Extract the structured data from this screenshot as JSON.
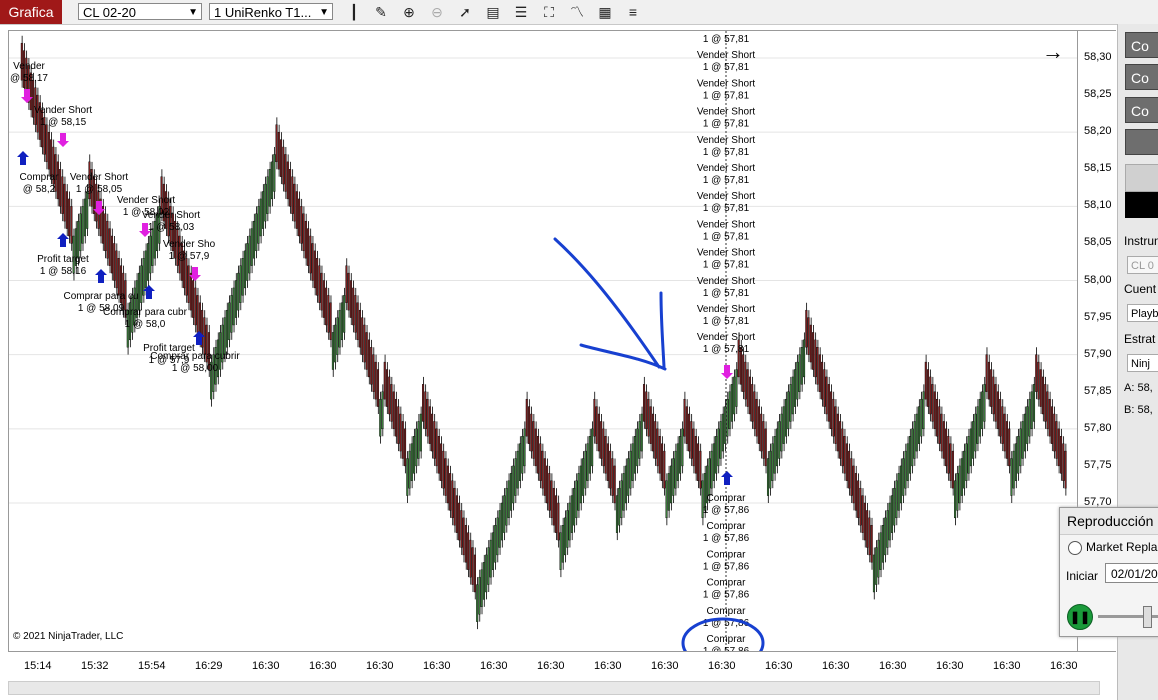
{
  "toolbar": {
    "tab_label": "Grafica",
    "instrument_select": "CL 02-20",
    "interval_select": "1 UniRenko T1...",
    "icons": [
      "bar-type-icon",
      "pencil-icon",
      "zoom-in-icon",
      "zoom-out-icon",
      "pointer-icon",
      "data-box-icon",
      "properties-icon",
      "screenshot-icon",
      "indicators-icon",
      "strategies-icon",
      "list-icon"
    ]
  },
  "y_axis": {
    "ticks": [
      "58,30",
      "58,25",
      "58,20",
      "58,15",
      "58,10",
      "58,05",
      "58,00",
      "57,95",
      "57,90",
      "57,85",
      "57,80",
      "57,75",
      "57,70"
    ],
    "range": [
      57.66,
      58.33
    ]
  },
  "x_axis": {
    "ticks": [
      "15:14",
      "15:32",
      "15:54",
      "16:29",
      "16:30",
      "16:30",
      "16:30",
      "16:30",
      "16:30",
      "16:30",
      "16:30",
      "16:30",
      "16:30",
      "16:30",
      "16:30",
      "16:30",
      "16:30",
      "16:30",
      "16:30"
    ]
  },
  "copyright": "© 2021 NinjaTrader, LLC",
  "right_panel": {
    "buttons": [
      "Co",
      "Co",
      "Co",
      ""
    ],
    "labels": {
      "instrument": "Instrum",
      "instrument_value": "CL 0",
      "account": "Cuent",
      "account_value": "Playb",
      "strategy": "Estrat",
      "strategy_value": "Ninj",
      "ask": "A:  58,",
      "bid": "B:  58,"
    }
  },
  "replay": {
    "title": "Reproducción",
    "market_replay": "Market Repla",
    "start_label": "Iniciar",
    "start_date": "02/01/20"
  },
  "annotations": {
    "left": [
      {
        "l1": "Vender",
        "l2": "@ 58,17"
      },
      {
        "l1": "Vender Short",
        "l2": "1 @ 58,15"
      },
      {
        "l1": "Comprar",
        "l2": "@ 58,2"
      },
      {
        "l1": "Vender Short",
        "l2": "1 @ 58,05"
      },
      {
        "l1": "Vender Short",
        "l2": "1 @ 58,02"
      },
      {
        "l1": "Vender Short",
        "l2": "1 @ 58,03"
      },
      {
        "l1": "Vender Sho",
        "l2": "1 @ 57,9"
      },
      {
        "l1": "Profit target",
        "l2": "1 @ 58,16"
      },
      {
        "l1": "Comprar para cu",
        "l2": "1 @ 58,09"
      },
      {
        "l1": "Comprar para cubr",
        "l2": "1 @ 58,0"
      },
      {
        "l1": "Profit target",
        "l2": "1 @ 57,9"
      },
      {
        "l1": "Comprar para cubrir",
        "l2": "1 @ 58,00"
      }
    ],
    "short_stack": {
      "l1": "Vender Short",
      "l2": "1 @ 57,81"
    },
    "buy_stack": {
      "l1": "Comprar",
      "l2": "1 @ 57,86"
    }
  },
  "chart_data": {
    "type": "candlestick",
    "ylim": [
      57.66,
      58.33
    ],
    "up_color": "#3a7a3a",
    "down_color": "#7a1e1e",
    "path_pivots": [
      58.28,
      58.17,
      58.05,
      58.12,
      57.95,
      58.1,
      57.88,
      58.17,
      57.92,
      57.98,
      57.83,
      57.85,
      57.75,
      57.82,
      57.58,
      57.8,
      57.65,
      57.8,
      57.7,
      57.82,
      57.72,
      57.8,
      57.72,
      57.88,
      57.75,
      57.92,
      57.8,
      57.62,
      57.85,
      57.72,
      57.86,
      57.75,
      57.86,
      57.72
    ]
  }
}
